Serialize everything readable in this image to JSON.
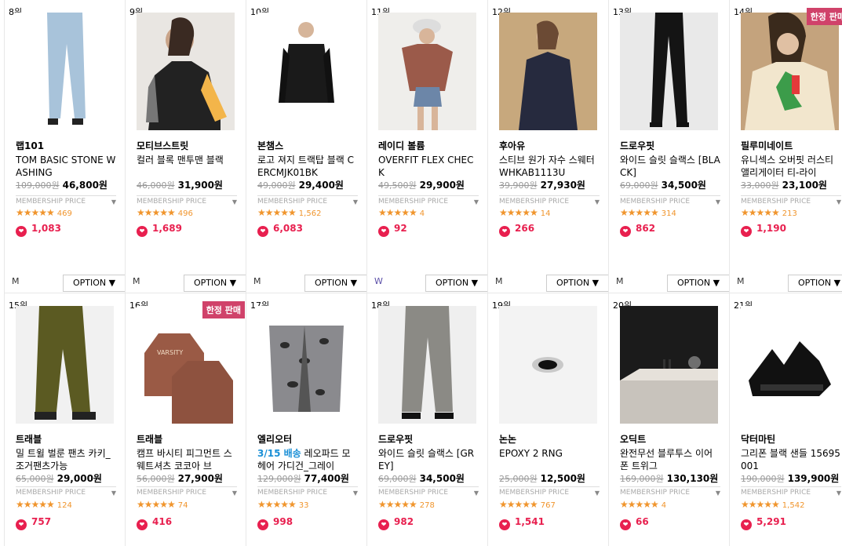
{
  "row1": [
    {
      "rank": "8위",
      "brand": "랩101",
      "name": "TOM BASIC STONE WASHING",
      "orig": "109,000원",
      "price": "46,800원",
      "member": "MEMBERSHIP PRICE",
      "stars": "★★★★★",
      "reviews": "469",
      "likes": "1,083",
      "size": "M",
      "option": "OPTION ▼",
      "badge": ""
    },
    {
      "rank": "9위",
      "brand": "모티브스트릿",
      "name": "컬러 블록 맨투맨 블랙",
      "orig": "46,000원",
      "price": "31,900원",
      "member": "MEMBERSHIP PRICE",
      "stars": "★★★★★",
      "reviews": "496",
      "likes": "1,689",
      "size": "M",
      "option": "OPTION ▼",
      "badge": ""
    },
    {
      "rank": "10위",
      "brand": "본챔스",
      "name": "로고 져지 트랙탑 블랙 CERCMJK01BK",
      "orig": "49,000원",
      "price": "29,400원",
      "member": "MEMBERSHIP PRICE",
      "stars": "★★★★★",
      "reviews": "1,562",
      "likes": "6,083",
      "size": "M",
      "option": "OPTION ▼",
      "badge": ""
    },
    {
      "rank": "11위",
      "brand": "레이디 볼륨",
      "name": "OVERFIT FLEX CHECK",
      "orig": "49,500원",
      "price": "29,900원",
      "member": "MEMBERSHIP PRICE",
      "stars": "★★★★★",
      "reviews": "4",
      "likes": "92",
      "size": "W",
      "option": "OPTION ▼",
      "badge": ""
    },
    {
      "rank": "12위",
      "brand": "후아유",
      "name": "스티브 원가 자수 스웨터 WHKAB1113U",
      "orig": "39,900원",
      "price": "27,930원",
      "member": "MEMBERSHIP PRICE",
      "stars": "★★★★★",
      "reviews": "14",
      "likes": "266",
      "size": "M",
      "option": "OPTION ▼",
      "badge": ""
    },
    {
      "rank": "13위",
      "brand": "드로우핏",
      "name": "와이드 슬릿 슬랙스 [BLACK]",
      "orig": "69,000원",
      "price": "34,500원",
      "member": "MEMBERSHIP PRICE",
      "stars": "★★★★★",
      "reviews": "314",
      "likes": "862",
      "size": "M",
      "option": "OPTION ▼",
      "badge": ""
    },
    {
      "rank": "14위",
      "brand": "필루미네이트",
      "name": "유니섹스 오버핏 러스티 앨리게이터 티-라이",
      "orig": "33,000원",
      "price": "23,100원",
      "member": "MEMBERSHIP PRICE",
      "stars": "★★★★★",
      "reviews": "213",
      "likes": "1,190",
      "size": "M",
      "option": "OPTION ▼",
      "badge": "한정 판매"
    }
  ],
  "row2": [
    {
      "rank": "15위",
      "brand": "트래블",
      "name": "밀 트윌 벌룬 팬츠 카키_조거팬츠가능",
      "orig": "65,000원",
      "price": "29,000원",
      "member": "MEMBERSHIP PRICE",
      "stars": "★★★★★",
      "reviews": "124",
      "likes": "757",
      "badge": "",
      "shipping": ""
    },
    {
      "rank": "16위",
      "brand": "트래블",
      "name": "캠프 바시티 피그먼트 스웨트셔츠 코코아 브",
      "orig": "56,000원",
      "price": "27,900원",
      "member": "MEMBERSHIP PRICE",
      "stars": "★★★★★",
      "reviews": "74",
      "likes": "416",
      "badge": "한정 판매",
      "shipping": ""
    },
    {
      "rank": "17위",
      "brand": "엘리오터",
      "name": "레오파드 모헤어 가디건_그레이",
      "orig": "129,000원",
      "price": "77,400원",
      "member": "MEMBERSHIP PRICE",
      "stars": "★★★★★",
      "reviews": "33",
      "likes": "998",
      "badge": "",
      "shipping": "3/15 배송"
    },
    {
      "rank": "18위",
      "brand": "드로우핏",
      "name": "와이드 슬릿 슬랙스 [GREY]",
      "orig": "69,000원",
      "price": "34,500원",
      "member": "MEMBERSHIP PRICE",
      "stars": "★★★★★",
      "reviews": "278",
      "likes": "982",
      "badge": "",
      "shipping": ""
    },
    {
      "rank": "19위",
      "brand": "논논",
      "name": "EPOXY 2 RNG",
      "orig": "25,000원",
      "price": "12,500원",
      "member": "MEMBERSHIP PRICE",
      "stars": "★★★★★",
      "reviews": "767",
      "likes": "1,541",
      "badge": "",
      "shipping": ""
    },
    {
      "rank": "20위",
      "brand": "오딕트",
      "name": "완전무선 블루투스 이어폰 트위그",
      "orig": "169,000원",
      "price": "130,130원",
      "member": "MEMBERSHIP PRICE",
      "stars": "★★★★★",
      "reviews": "4",
      "likes": "66",
      "badge": "",
      "shipping": ""
    },
    {
      "rank": "21위",
      "brand": "닥터마틴",
      "name": "그리폰 블랙 샌들 15695001",
      "orig": "190,000원",
      "price": "139,900원",
      "member": "MEMBERSHIP PRICE",
      "stars": "★★★★★",
      "reviews": "1,542",
      "likes": "5,291",
      "badge": "",
      "shipping": ""
    }
  ],
  "icons": {
    "heart": "heart-icon",
    "triangle": "dropdown-triangle-icon"
  },
  "colors": {
    "accent": "#e8204f",
    "star": "#f0952d",
    "badge": "#d0426a",
    "shipping": "#1a8fd6"
  }
}
